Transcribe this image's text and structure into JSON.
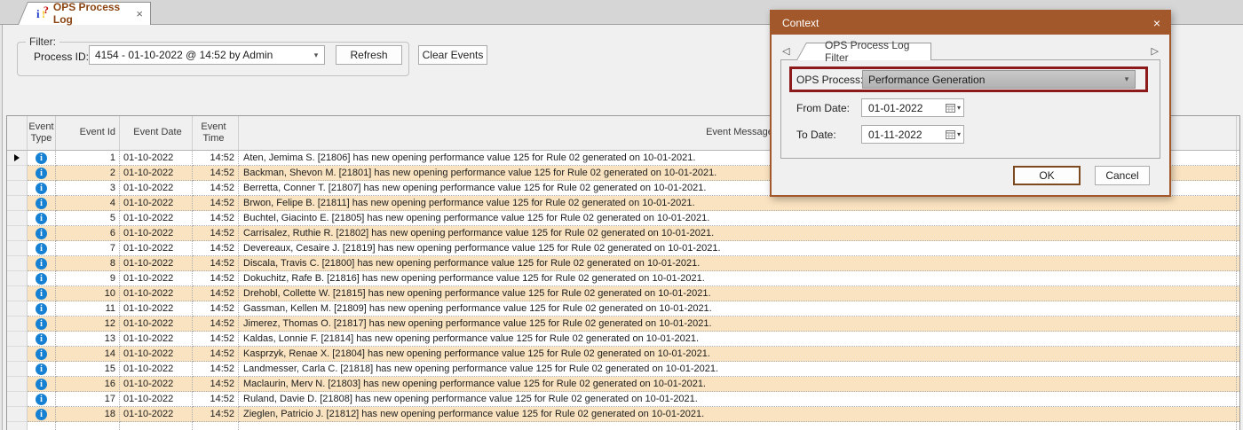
{
  "colors": {
    "dialog_brown": "#A2582A",
    "highlight_red": "#8C1A1A",
    "alt_row": "#FAE3C0",
    "info_blue": "#1681D2",
    "tab_text_brown": "#8B4513"
  },
  "tab_bar": {
    "active_tab": {
      "label": "OPS Process Log",
      "close_icon": "×"
    }
  },
  "filter": {
    "group_label": "Filter:",
    "process_id_label": "Process ID:",
    "process_id_value": "4154 - 01-10-2022 @ 14:52 by Admin",
    "dropdown_arrow": "▾",
    "refresh_label": "Refresh",
    "clear_events_label": "Clear Events"
  },
  "table": {
    "columns": [
      "Event Type",
      "Event Id",
      "Event Date",
      "Event Time",
      "Event Message"
    ],
    "rows": [
      {
        "current": true,
        "event_id": 1,
        "event_date": "01-10-2022",
        "event_time": "14:52",
        "event_message": "Aten, Jemima S. [21806] has new opening performance value 125 for Rule 02 generated on 10-01-2021."
      },
      {
        "current": false,
        "event_id": 2,
        "event_date": "01-10-2022",
        "event_time": "14:52",
        "event_message": "Backman, Shevon M. [21801] has new opening performance value 125 for Rule 02 generated on 10-01-2021."
      },
      {
        "current": false,
        "event_id": 3,
        "event_date": "01-10-2022",
        "event_time": "14:52",
        "event_message": "Berretta, Conner T. [21807] has new opening performance value 125 for Rule 02 generated on 10-01-2021."
      },
      {
        "current": false,
        "event_id": 4,
        "event_date": "01-10-2022",
        "event_time": "14:52",
        "event_message": "Brwon, Felipe B. [21811] has new opening performance value 125 for Rule 02 generated on 10-01-2021."
      },
      {
        "current": false,
        "event_id": 5,
        "event_date": "01-10-2022",
        "event_time": "14:52",
        "event_message": "Buchtel, Giacinto E. [21805] has new opening performance value 125 for Rule 02 generated on 10-01-2021."
      },
      {
        "current": false,
        "event_id": 6,
        "event_date": "01-10-2022",
        "event_time": "14:52",
        "event_message": "Carrisalez, Ruthie R. [21802] has new opening performance value 125 for Rule 02 generated on 10-01-2021."
      },
      {
        "current": false,
        "event_id": 7,
        "event_date": "01-10-2022",
        "event_time": "14:52",
        "event_message": "Devereaux, Cesaire J. [21819] has new opening performance value 125 for Rule 02 generated on 10-01-2021."
      },
      {
        "current": false,
        "event_id": 8,
        "event_date": "01-10-2022",
        "event_time": "14:52",
        "event_message": "Discala, Travis C. [21800] has new opening performance value 125 for Rule 02 generated on 10-01-2021."
      },
      {
        "current": false,
        "event_id": 9,
        "event_date": "01-10-2022",
        "event_time": "14:52",
        "event_message": "Dokuchitz, Rafe B. [21816] has new opening performance value 125 for Rule 02 generated on 10-01-2021."
      },
      {
        "current": false,
        "event_id": 10,
        "event_date": "01-10-2022",
        "event_time": "14:52",
        "event_message": "Drehobl, Collette W. [21815] has new opening performance value 125 for Rule 02 generated on 10-01-2021."
      },
      {
        "current": false,
        "event_id": 11,
        "event_date": "01-10-2022",
        "event_time": "14:52",
        "event_message": "Gassman, Kellen M. [21809] has new opening performance value 125 for Rule 02 generated on 10-01-2021."
      },
      {
        "current": false,
        "event_id": 12,
        "event_date": "01-10-2022",
        "event_time": "14:52",
        "event_message": "Jimerez, Thomas O. [21817] has new opening performance value 125 for Rule 02 generated on 10-01-2021."
      },
      {
        "current": false,
        "event_id": 13,
        "event_date": "01-10-2022",
        "event_time": "14:52",
        "event_message": "Kaldas, Lonnie F. [21814] has new opening performance value 125 for Rule 02 generated on 10-01-2021."
      },
      {
        "current": false,
        "event_id": 14,
        "event_date": "01-10-2022",
        "event_time": "14:52",
        "event_message": "Kasprzyk, Renae X. [21804] has new opening performance value 125 for Rule 02 generated on 10-01-2021."
      },
      {
        "current": false,
        "event_id": 15,
        "event_date": "01-10-2022",
        "event_time": "14:52",
        "event_message": "Landmesser, Carla C. [21818] has new opening performance value 125 for Rule 02 generated on 10-01-2021."
      },
      {
        "current": false,
        "event_id": 16,
        "event_date": "01-10-2022",
        "event_time": "14:52",
        "event_message": "Maclaurin, Merv N. [21803] has new opening performance value 125 for Rule 02 generated on 10-01-2021."
      },
      {
        "current": false,
        "event_id": 17,
        "event_date": "01-10-2022",
        "event_time": "14:52",
        "event_message": "Ruland, Davie D. [21808] has new opening performance value 125 for Rule 02 generated on 10-01-2021."
      },
      {
        "current": false,
        "event_id": 18,
        "event_date": "01-10-2022",
        "event_time": "14:52",
        "event_message": "Zieglen, Patricio J. [21812] has new opening performance value 125 for Rule 02 generated on 10-01-2021."
      }
    ]
  },
  "dialog": {
    "title": "Context",
    "close_icon": "×",
    "tab_label": "OPS Process Log Filter",
    "tab_scroll_left": "◁",
    "tab_scroll_right": "▷",
    "fields": {
      "ops_process_label": "OPS Process:",
      "ops_process_value": "Performance Generation",
      "from_date_label": "From Date:",
      "from_date_value": "01-01-2022",
      "to_date_label": "To Date:",
      "to_date_value": "01-11-2022",
      "dropdown_arrow": "▾"
    },
    "ok_label": "OK",
    "cancel_label": "Cancel"
  }
}
